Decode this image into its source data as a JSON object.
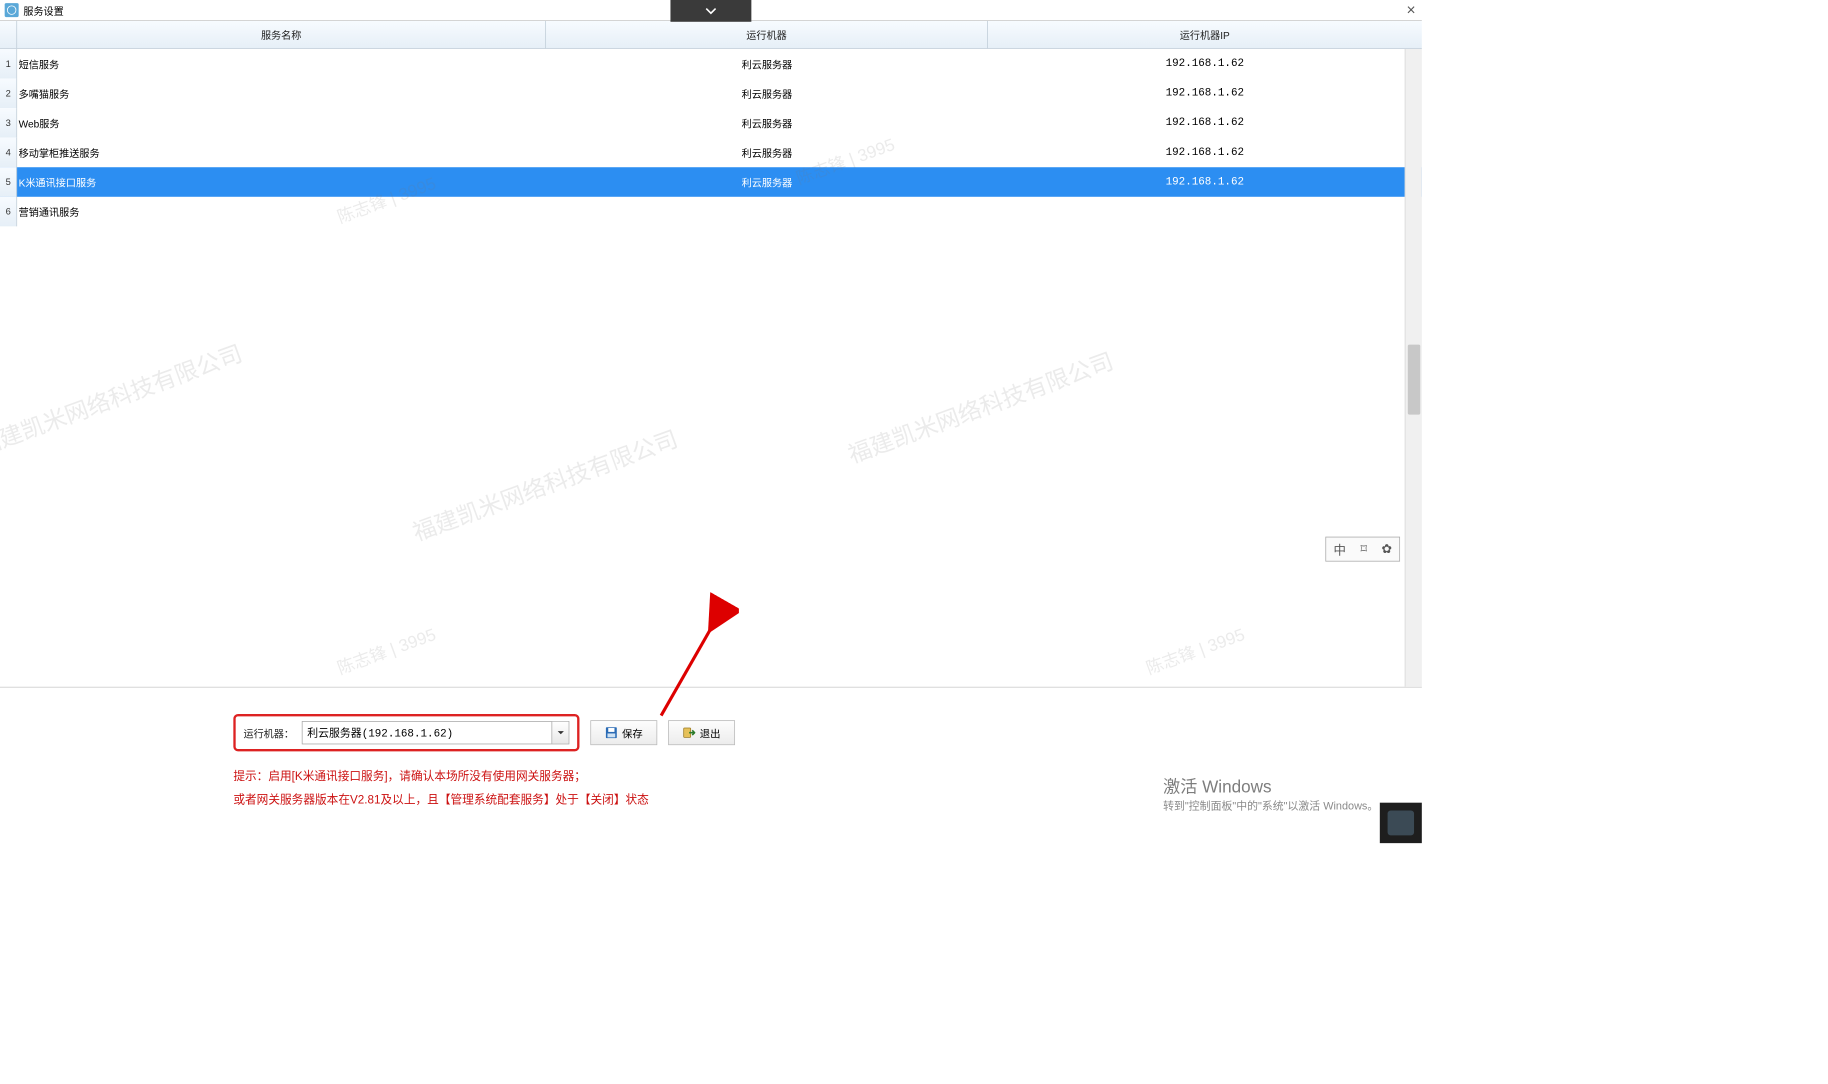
{
  "window": {
    "title": "服务设置",
    "close": "×"
  },
  "dropdown_tab": {
    "label": "expand"
  },
  "table": {
    "headers": {
      "name": "服务名称",
      "machine": "运行机器",
      "ip": "运行机器IP"
    },
    "rows": [
      {
        "n": "1",
        "name": "短信服务",
        "machine": "利云服务器",
        "ip": "192.168.1.62",
        "selected": false
      },
      {
        "n": "2",
        "name": "多嘴猫服务",
        "machine": "利云服务器",
        "ip": "192.168.1.62",
        "selected": false
      },
      {
        "n": "3",
        "name": "Web服务",
        "machine": "利云服务器",
        "ip": "192.168.1.62",
        "selected": false
      },
      {
        "n": "4",
        "name": "移动掌柜推送服务",
        "machine": "利云服务器",
        "ip": "192.168.1.62",
        "selected": false
      },
      {
        "n": "5",
        "name": "K米通讯接口服务",
        "machine": "利云服务器",
        "ip": "192.168.1.62",
        "selected": true
      },
      {
        "n": "6",
        "name": "营销通讯服务",
        "machine": "",
        "ip": "",
        "selected": false
      }
    ]
  },
  "watermarks": {
    "company": "福建凯米网络科技有限公司",
    "user": "陈志锋 | 3995"
  },
  "ime": {
    "c1": "中",
    "c2": "⌑",
    "c3": "✿"
  },
  "form": {
    "label": "运行机器：",
    "combo_value": "利云服务器(192.168.1.62)",
    "save": "保存",
    "exit": "退出"
  },
  "hint": {
    "line1": "提示：启用[K米通讯接口服务]，请确认本场所没有使用网关服务器；",
    "line2": "或者网关服务器版本在V2.81及以上，且【管理系统配套服务】处于【关闭】状态"
  },
  "activate": {
    "title": "激活 Windows",
    "sub": "转到\"控制面板\"中的\"系统\"以激活 Windows。"
  }
}
